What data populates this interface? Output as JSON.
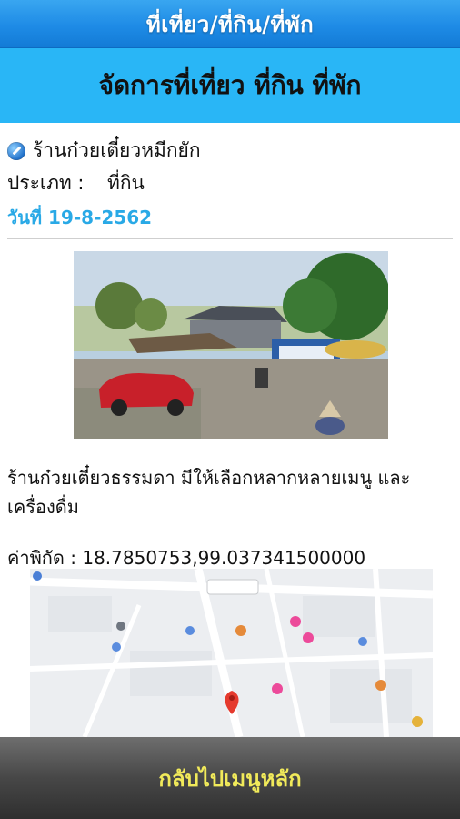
{
  "top_bar": {
    "title": "ที่เที่ยว/ที่กิน/ที่พัก"
  },
  "header": {
    "title": "จัดการที่เที่ยว ที่กิน ที่พัก"
  },
  "place": {
    "icon": "pencil-icon",
    "name": "ร้านก๋วยเตี๋ยวหมีกยัก",
    "type_label": "ประเภท :",
    "type_value": "ที่กิน",
    "date": "วันที่ 19-8-2562",
    "description": "ร้านก๋วยเตี๋ยวธรรมดา มีให้เลือกหลากหลายเมนู และเครื่องดื่ม",
    "coords": "ค่าพิกัด : 18.7850753,99.037341500000"
  },
  "colors": {
    "top_bar": "#1e8be6",
    "header_band": "#29b6f6",
    "date_text": "#29a9e6",
    "bottom_label": "#f1ea5a"
  },
  "bottom_bar": {
    "label": "กลับไปเมนูหลัก"
  }
}
